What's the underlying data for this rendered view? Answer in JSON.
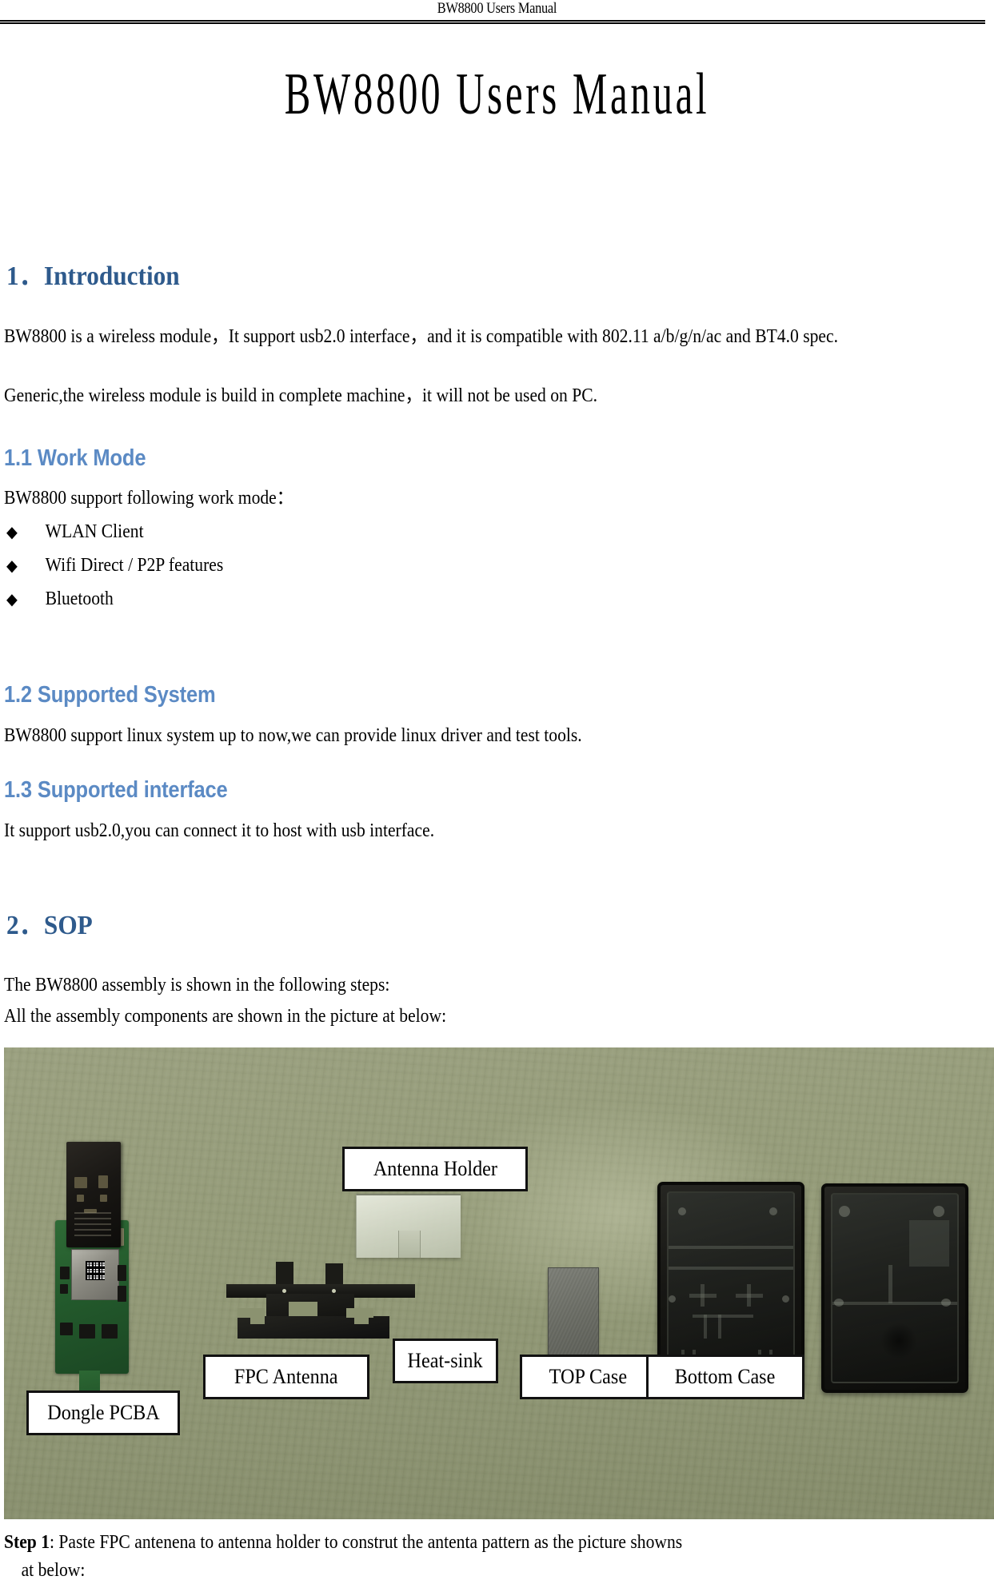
{
  "header": {
    "running_title": "BW8800 Users Manual"
  },
  "title": "BW8800 Users Manual",
  "colors": {
    "heading_primary": "#2E5A8C",
    "heading_secondary": "#5B8AC4",
    "body_text": "#000000",
    "photo_background": "#8b9270"
  },
  "sections": {
    "intro": {
      "heading": "1．Introduction",
      "paragraph_1": "BW8800 is a wireless module，It support usb2.0 interface，and it is compatible with 802.11 a/b/g/n/ac and BT4.0 spec.",
      "paragraph_2": "Generic,the wireless module is build in complete machine，it will not be used on PC."
    },
    "work_mode": {
      "heading": "1.1 Work Mode",
      "lead_in": "BW8800 support following work mode：",
      "bullet_symbol": "◆",
      "bullets": [
        "WLAN Client",
        "Wifi Direct / P2P features",
        "Bluetooth"
      ]
    },
    "supported_system": {
      "heading": "1.2 Supported System",
      "paragraph": "BW8800 support linux system up to now,we can provide linux driver and test tools."
    },
    "supported_interface": {
      "heading": "1.3 Supported interface",
      "paragraph": "It support usb2.0,you can connect it to host with usb interface."
    },
    "sop": {
      "heading": "2．SOP",
      "paragraph_1": "The BW8800 assembly is shown in the following steps:",
      "paragraph_2": "All the assembly components are shown in the picture at below:"
    }
  },
  "figure": {
    "labels": {
      "antenna_holder": "Antenna Holder",
      "dongle_pcba": "Dongle PCBA",
      "fpc_antenna": "FPC Antenna",
      "heat_sink": "Heat-sink",
      "top_case": "TOP Case",
      "bottom_case": "Bottom Case"
    }
  },
  "step": {
    "label": "Step 1",
    "text_line_1": ": Paste FPC antenena to antenna holder to construt the antenta pattern as the picture showns",
    "text_line_2": "at below:"
  }
}
